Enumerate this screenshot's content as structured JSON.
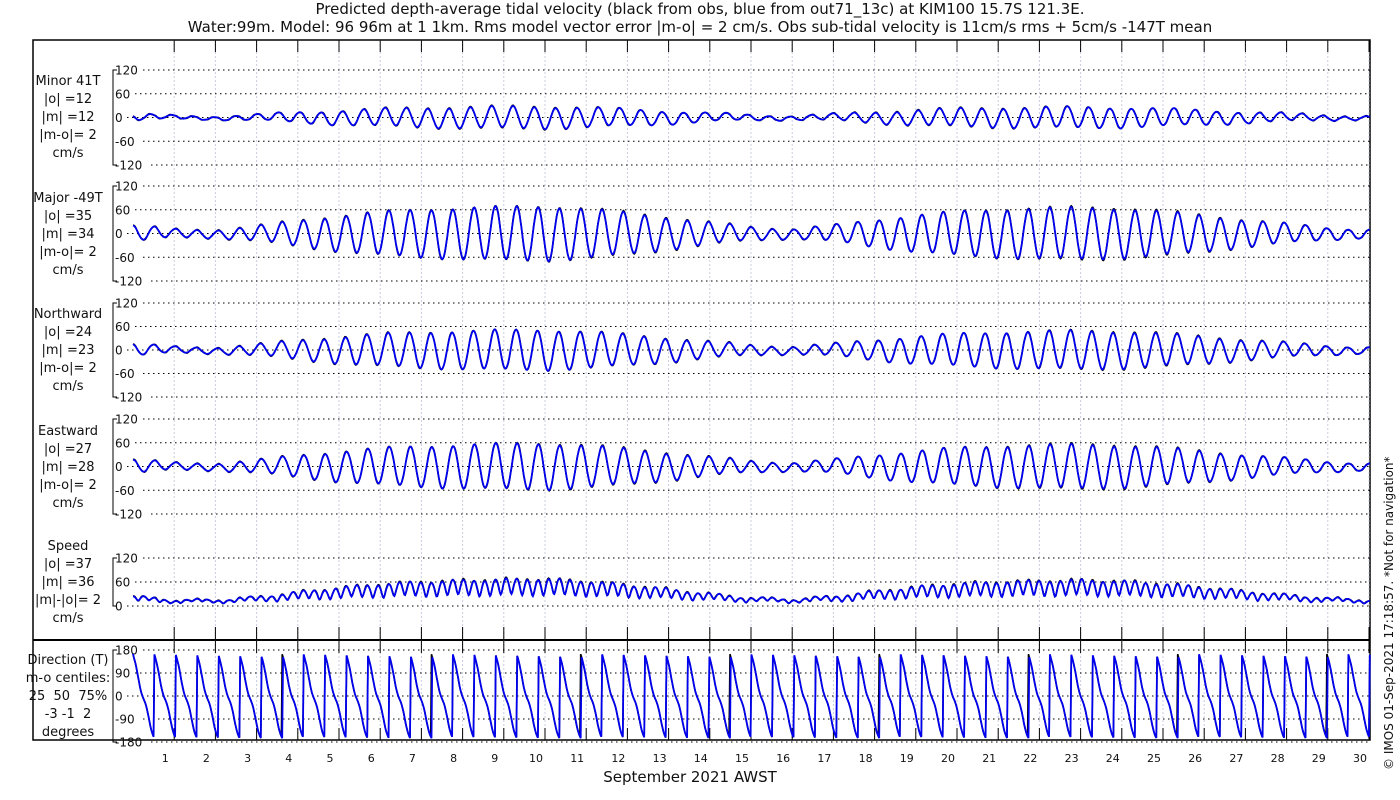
{
  "title_line1": "Predicted depth-average tidal velocity (black from obs, blue from out71_13c) at KIM100 15.7S 121.3E.",
  "title_line2": "Water:99m. Model: 96 96m at 1 1km. Rms model vector error |m-o| = 2 cm/s. Obs sub-tidal velocity is 11cm/s rms + 5cm/s -147T mean",
  "copyright": "© IMOS 01-Sep-2021 17:18:57. *Not for navigation*",
  "colors": {
    "obs": "#000000",
    "model": "#0000ee",
    "grid": "#000000",
    "vgrid": "#c8cce0"
  },
  "chart_data": {
    "type": "line",
    "xlabel": "September 2021 AWST",
    "x_range_days": [
      0,
      30.02
    ],
    "x_tick_labels": [
      "1",
      "2",
      "3",
      "4",
      "5",
      "6",
      "7",
      "8",
      "9",
      "10",
      "11",
      "12",
      "13",
      "14",
      "15",
      "16",
      "17",
      "18",
      "19",
      "20",
      "21",
      "22",
      "23",
      "24",
      "25",
      "26",
      "27",
      "28",
      "29",
      "30"
    ],
    "tidal_period_days": 0.5175,
    "major_envelope_by_day": [
      20,
      10,
      10,
      18,
      32,
      44,
      54,
      60,
      64,
      67,
      68,
      62,
      52,
      40,
      27,
      16,
      12,
      20,
      34,
      46,
      55,
      60,
      63,
      65,
      62,
      55,
      45,
      34,
      24,
      15,
      10
    ],
    "series": [
      {
        "name": "obs (black)"
      },
      {
        "name": "model (blue)"
      }
    ],
    "panels": [
      {
        "key": "minor",
        "labels": [
          "Minor 41T",
          "|o| =12",
          "|m| =12",
          "|m-o|= 2",
          "cm/s"
        ],
        "ylim": [
          -120,
          120
        ],
        "yticks": [
          "120",
          "60",
          "0",
          "-60",
          "-120"
        ],
        "ratio": 0.4
      },
      {
        "key": "major",
        "labels": [
          "Major -49T",
          "|o| =35",
          "|m| =34",
          "|m-o|= 2",
          "cm/s"
        ],
        "ylim": [
          -120,
          120
        ],
        "yticks": [
          "120",
          "60",
          "0",
          "-60",
          "-120"
        ],
        "ratio": 1.0
      },
      {
        "key": "north",
        "labels": [
          "Northward",
          "|o| =24",
          "|m| =23",
          "|m-o|= 2",
          "cm/s"
        ],
        "ylim": [
          -120,
          120
        ],
        "yticks": [
          "120",
          "60",
          "0",
          "-60",
          "-120"
        ],
        "ratio": 0.75
      },
      {
        "key": "east",
        "labels": [
          "Eastward",
          "|o| =27",
          "|m| =28",
          "|m-o|= 2",
          "cm/s"
        ],
        "ylim": [
          -120,
          120
        ],
        "yticks": [
          "120",
          "60",
          "0",
          "-60",
          "-120"
        ],
        "ratio": 0.85
      },
      {
        "key": "speed",
        "labels": [
          "Speed",
          "|o| =37",
          "|m| =36",
          "|m|-|o|= 2",
          "cm/s"
        ],
        "ylim": [
          0,
          120
        ],
        "yticks": [
          "120",
          "60",
          "0"
        ],
        "ratio": 1.0
      },
      {
        "key": "direction",
        "labels": [
          "Direction (T)",
          "m-o centiles:",
          "25  50  75%",
          "-3 -1  2",
          "degrees"
        ],
        "ylim": [
          -180,
          180
        ],
        "yticks": [
          "180",
          "90",
          "0",
          "-90",
          "-180"
        ],
        "ratio": 1.0
      }
    ]
  }
}
